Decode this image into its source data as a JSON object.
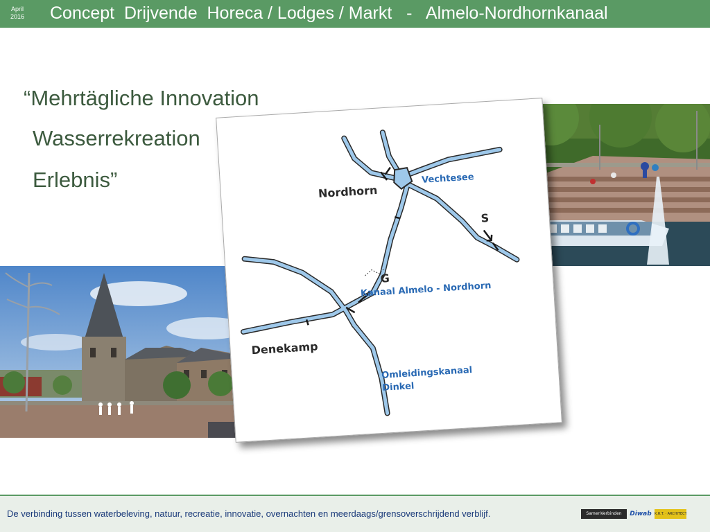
{
  "header": {
    "date_line1": "April",
    "date_line2": "2016",
    "title": "Concept  Drijvende  Horeca / Lodges / Markt   -   Almelo-Nordhornkanaal"
  },
  "quote": {
    "line1": "“Mehrtägliche Innovation",
    "line2": "Wasserrekreation",
    "line3": "Erlebnis”"
  },
  "map": {
    "city_nordhorn": "Nordhorn",
    "city_denekamp": "Denekamp",
    "water_vechtesee": "Vechtesee",
    "marker_s": "S",
    "marker_g": "G",
    "canal_almelo_nordhorn": "Kanaal Almelo - Nordhorn",
    "canal_omleiding_1": "Omleidingskanaal",
    "canal_omleiding_2": "Dinkel"
  },
  "footer": {
    "text": "De verbinding tussen waterbeleving, natuur, recreatie, innovatie, overnachten en meerdaags/grensoverschrijdend verblijf.",
    "logo1": "SamenVerbinden",
    "logo2": "Diwab",
    "logo3": "K.R.T. · ARCHITECTEN"
  },
  "colors": {
    "header_green": "#5a9a64",
    "quote_text": "#3c5a3e",
    "footer_text": "#1a3a7a",
    "map_water": "#2a6ab4"
  }
}
